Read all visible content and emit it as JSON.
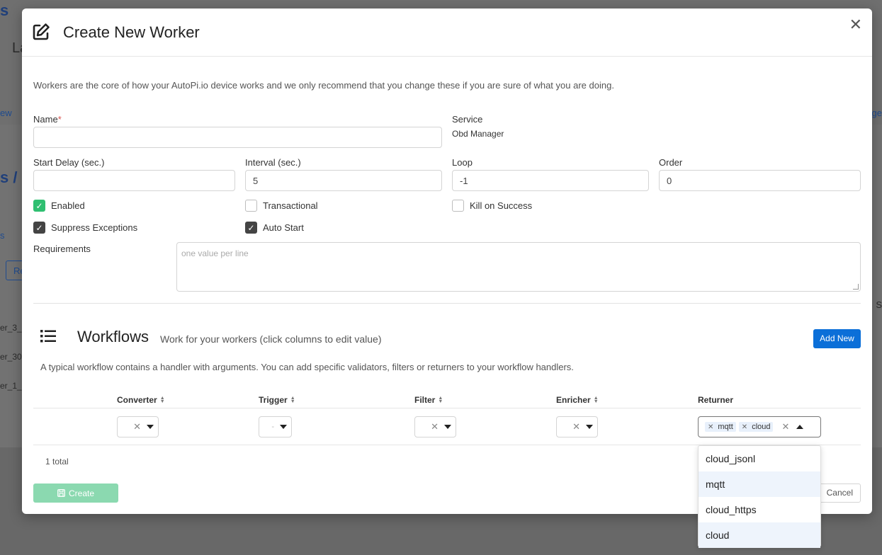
{
  "background": {
    "frag_s": "s",
    "frag_la": "La",
    "frag_ew": "ew",
    "frag_slash": "s /",
    "frag_tab": "s",
    "frag_re": "Re",
    "rows": [
      "er_3_",
      "er_30",
      "er_1_"
    ],
    "frag_right": "ge",
    "frag_right2": "S"
  },
  "modal": {
    "title": "Create New Worker",
    "close": "✕",
    "intro": "Workers are the core of how your AutoPi.io device works and we only recommend that you change these if you are sure of what you are doing."
  },
  "form": {
    "name_label": "Name",
    "required_mark": "*",
    "name_value": "",
    "service_label": "Service",
    "service_value": "Obd Manager",
    "start_delay_label": "Start Delay (sec.)",
    "start_delay_value": "",
    "interval_label": "Interval (sec.)",
    "interval_value": "5",
    "loop_label": "Loop",
    "loop_value": "-1",
    "order_label": "Order",
    "order_value": "0",
    "checkboxes": {
      "enabled": {
        "label": "Enabled",
        "checked": true
      },
      "transactional": {
        "label": "Transactional",
        "checked": false
      },
      "kill_on_success": {
        "label": "Kill on Success",
        "checked": false
      },
      "suppress_exceptions": {
        "label": "Suppress Exceptions",
        "checked": true
      },
      "auto_start": {
        "label": "Auto Start",
        "checked": true
      }
    },
    "requirements_label": "Requirements",
    "requirements_placeholder": "one value per line"
  },
  "workflows": {
    "title": "Workflows",
    "subtitle": "Work for your workers (click columns to edit value)",
    "add_button": "Add New",
    "description": "A typical workflow contains a handler with arguments. You can add specific validators, filters or returners to your workflow handlers.",
    "columns": [
      "Converter",
      "Trigger",
      "Filter",
      "Enricher",
      "Returner"
    ],
    "row": {
      "converter": "",
      "trigger": "-",
      "filter": "",
      "enricher": "",
      "returner_tags": [
        "mqtt",
        "cloud"
      ]
    },
    "total": "1 total"
  },
  "returner_dropdown": {
    "options": [
      "cloud_jsonl",
      "mqtt",
      "cloud_https",
      "cloud"
    ],
    "selected": [
      "mqtt",
      "cloud"
    ]
  },
  "footer": {
    "create": "Create",
    "cancel": "Cancel"
  },
  "colors": {
    "primary": "#0b6fd8",
    "success": "#2fbf71",
    "create_disabled": "#8bd9b0"
  }
}
